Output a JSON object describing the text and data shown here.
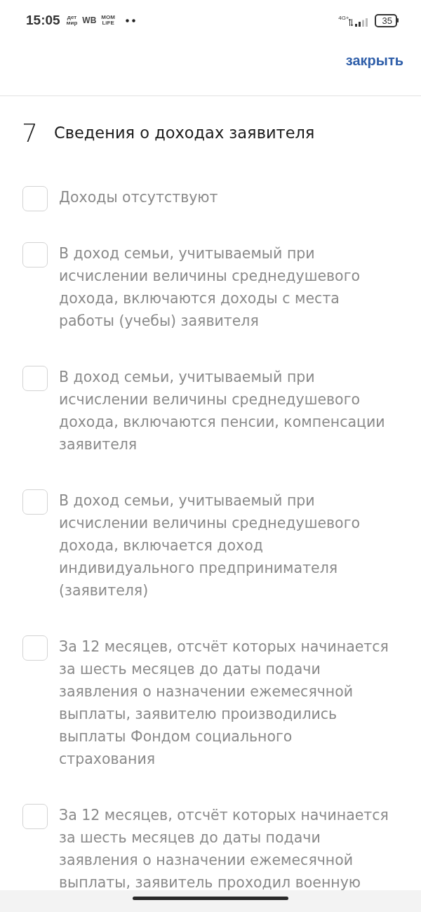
{
  "status_bar": {
    "time": "15:05",
    "notifications": [
      {
        "lines": [
          "дет",
          "мир"
        ]
      },
      {
        "lines": [
          "WB"
        ]
      },
      {
        "lines": [
          "MOM",
          "LiFE"
        ]
      }
    ],
    "network": "4G+",
    "battery": "35"
  },
  "header": {
    "close_link": "закрыть"
  },
  "section": {
    "number": "7",
    "title": "Сведения о доходах заявителя"
  },
  "options": [
    {
      "label": "Доходы отсутствуют",
      "checked": false
    },
    {
      "label": "В доход семьи, учитываемый при исчислении величины среднедушевого дохода, включаются доходы с места работы (учебы) заявителя",
      "checked": false
    },
    {
      "label": "В доход семьи, учитываемый при исчислении величины среднедушевого дохода, включаются пенсии, компенсации заявителя",
      "checked": false
    },
    {
      "label": "В доход семьи, учитываемый при исчислении величины среднедушевого дохода, включается доход индивидуального предпринимателя (заявителя)",
      "checked": false
    },
    {
      "label": "За 12 месяцев, отсчёт которых начинается за шесть месяцев до даты подачи заявления о назначении ежемесячной выплаты, заявителю производились выплаты Фондом социального страхования",
      "checked": false
    },
    {
      "label": "За 12 месяцев, отсчёт которых начинается за шесть месяцев до даты подачи заявления о назначении ежемесячной выплаты, заявитель проходил военную",
      "checked": false
    }
  ]
}
